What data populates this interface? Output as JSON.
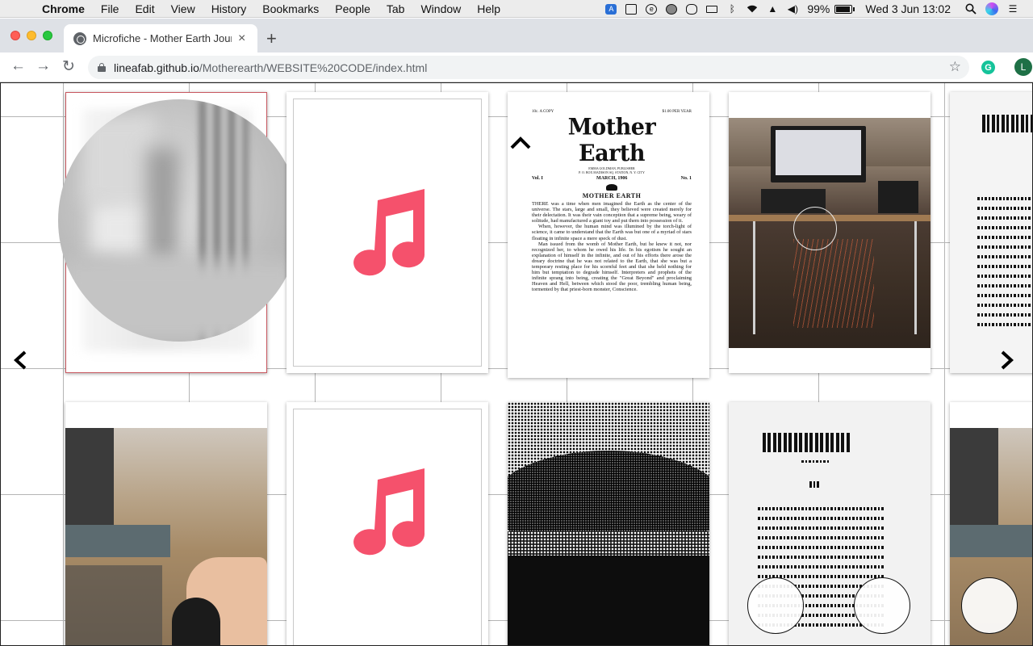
{
  "menubar": {
    "app": "Chrome",
    "items": [
      "File",
      "Edit",
      "View",
      "History",
      "Bookmarks",
      "People",
      "Tab",
      "Window",
      "Help"
    ],
    "battery": "99%",
    "battery_level": 0.99,
    "clock": "Wed 3 Jun  13:02"
  },
  "browser": {
    "tab_title": "Microfiche - Mother Earth Jour",
    "tab_close": "×",
    "new_tab": "+",
    "url_host": "lineafab.github.io",
    "url_path": "/Motherearth/WEBSITE%20CODE/index.html",
    "extension_label": "G",
    "profile_initial": "L"
  },
  "document": {
    "price_left": "10c. A COPY",
    "price_right": "$1.00 PER YEAR",
    "masthead": "Mother Earth",
    "publisher": "EMMA GOLDMAN, PUBLISHER",
    "address": "P. O. BOX MADISON SQ. STATION, N. Y. CITY",
    "vol": "Vol. I",
    "date": "MARCH, 1906",
    "number": "No. 1",
    "section": "MOTHER EARTH",
    "para1": "THERE was a time when men imagined the Earth as the center of the universe. The stars, large and small, they believed were created merely for their delectation. It was their vain conception that a supreme being, weary of solitude, had manufactured a giant toy and put them into possession of it.",
    "para2": "When, however, the human mind was illumined by the torch-light of science, it came to understand that the Earth was but one of a myriad of stars floating in infinite space a mere speck of dust.",
    "para3": "Man issued from the womb of Mother Earth, but he knew it not, nor recognized her, to whom he owed his life. In his egotism he sought an explanation of himself in the infinite, and out of his efforts there arose the dreary doctrine that he was not related to the Earth, that she was but a temporary resting place for his scornful feet and that she held nothing for him but temptation to degrade himself. Interpreters and prophets of the infinite sprang into being, creating the \"Great Beyond\" and proclaiming Heaven and Hell, between which stood the poor, trembling human being, tormented by that priest-born monster, Conscience."
  },
  "icons": {
    "prev": "prev-chevron-icon",
    "next": "next-chevron-icon",
    "up": "up-chevron-icon",
    "music": "music-note-icon"
  },
  "colors": {
    "music_note": "#f5516c",
    "selected_border": "#c8575f"
  }
}
